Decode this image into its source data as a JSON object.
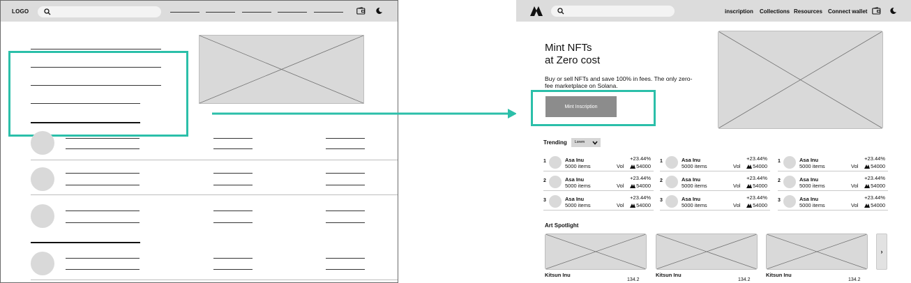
{
  "lofi": {
    "logo": "LOGO"
  },
  "hifi": {
    "nav": {
      "items": [
        {
          "label": "inscription"
        },
        {
          "label": "Collections"
        },
        {
          "label": "Resources"
        },
        {
          "label": "Connect wallet"
        }
      ]
    },
    "hero": {
      "title_line1": "Mint NFTs",
      "title_line2": "at Zero cost",
      "subtitle": "Buy or sell NFTs and save 100% in fees. The only zero-fee marketplace on Solana.",
      "cta_label": "Mint Inscription"
    },
    "trending": {
      "title": "Trending",
      "filter": "Lorem",
      "rows": [
        {
          "rank": "1",
          "name": "Asa Inu",
          "items": "5000 items",
          "change": "+23.44%",
          "vol_label": "Vol",
          "vol": "54000"
        },
        {
          "rank": "2",
          "name": "Asa Inu",
          "items": "5000 items",
          "change": "+23.44%",
          "vol_label": "Vol",
          "vol": "54000"
        },
        {
          "rank": "3",
          "name": "Asa Inu",
          "items": "5000 items",
          "change": "+23.44%",
          "vol_label": "Vol",
          "vol": "54000"
        }
      ]
    },
    "spotlight": {
      "title": "Art Spotlight",
      "cards": [
        {
          "name": "Kitsun Inu",
          "price": "134.2"
        },
        {
          "name": "Kitsun Inu",
          "price": "134.2"
        },
        {
          "name": "Kitsun Inu",
          "price": "134.2"
        }
      ],
      "next_label": "›"
    }
  },
  "colors": {
    "highlight": "#2bbfa9",
    "topbar": "#dcdcdc",
    "placeholder": "#d9d9d9",
    "cta": "#8c8c8c"
  },
  "icons": [
    "search-icon",
    "wallet-icon",
    "moon-icon",
    "brand-logo-icon",
    "chevron-down-icon",
    "chevron-right-icon",
    "solana-icon",
    "arrow-icon"
  ]
}
